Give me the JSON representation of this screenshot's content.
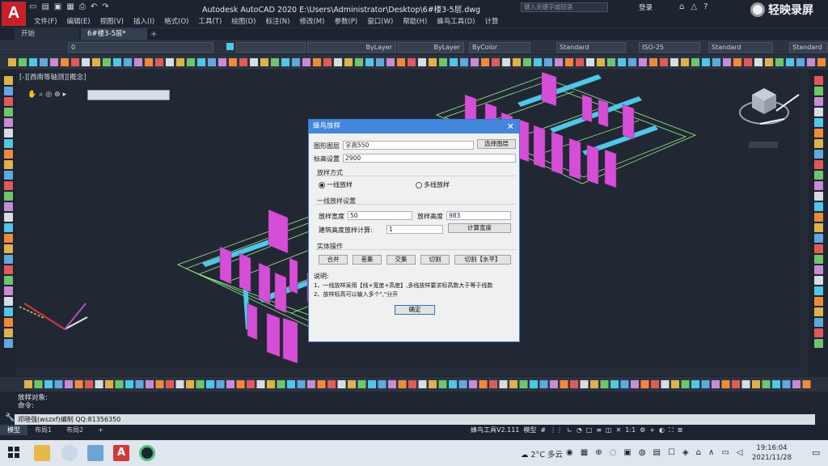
{
  "window": {
    "app_logo": "A",
    "title": "Autodesk AutoCAD 2020    E:\\Users\\Administrator\\Desktop\\6#楼3-5层.dwg",
    "search_placeholder": "键入关键字或短语",
    "login": "登录",
    "brand": "轻映录屏"
  },
  "menu": [
    "文件(F)",
    "编辑(E)",
    "视图(V)",
    "插入(I)",
    "格式(O)",
    "工具(T)",
    "绘图(D)",
    "标注(N)",
    "修改(M)",
    "参数(P)",
    "窗口(W)",
    "帮助(H)",
    "蜂鸟工具(D)",
    "计算"
  ],
  "doc_tabs": {
    "start": "开始",
    "drawing": "6#楼3-5层*",
    "add": "+"
  },
  "properties": {
    "layer": "0",
    "color_layer": "ByLayer",
    "linetype": "ByLayer",
    "lineweight": "ByColor",
    "text_style": "Standard",
    "dim_style": "ISO-25",
    "table_style": "Standard",
    "mleader_style": "Standard"
  },
  "viewport_label": "[-][西南等轴测][概念]",
  "command": {
    "history_1": "放样对象:",
    "history_2": "命令:",
    "input": "邓晓强(wszxf)编制 QQ:81356350"
  },
  "layout_tabs": [
    "模型",
    "布局1",
    "布局2",
    "+"
  ],
  "status": {
    "plugin": "蜂鸟工具V2.111",
    "model": "模型",
    "scale": "1:1"
  },
  "taskbar": {
    "weather_temp": "2°C",
    "weather_text": "多云",
    "time": "19:16:04",
    "date": "2021/11/28"
  },
  "dialog": {
    "title": "蜂鸟放样",
    "close": "✕",
    "pattern_label": "图形图层",
    "pattern_value": "字高550",
    "select_layer_btn": "选择图层",
    "elevation_label": "标高设置",
    "elevation_value": "2900",
    "mode_group": "放样方式",
    "mode_single": "一线放样",
    "mode_multi": "多线放样",
    "single_group": "一线放样设置",
    "width_label": "放样宽度",
    "width_value": "50",
    "height_label": "放样高度",
    "height_value": "983",
    "count_label": "建筑高度放样计算:",
    "count_value": "1",
    "calc_btn": "计算宽度",
    "entity_group": "实体操作",
    "btn_union": "合并",
    "btn_subtract": "差集",
    "btn_intersect": "交集",
    "btn_cut": "切割",
    "btn_cut_horizontal": "切割【水平】",
    "note_title": "说明:",
    "note_1": "1、一线放样采用【线+宽度+高度】,多线放样要求标高数大于等于线数",
    "note_2": "2、放样标高可以输入多个\",\"分开",
    "ok_btn": "确定"
  },
  "colors": {
    "accent": "#4486d9",
    "wall_magenta": "#d64ed8",
    "slab_cyan": "#4fc7e8",
    "outline_green": "#9ef08a",
    "app_red": "#c8202a"
  }
}
